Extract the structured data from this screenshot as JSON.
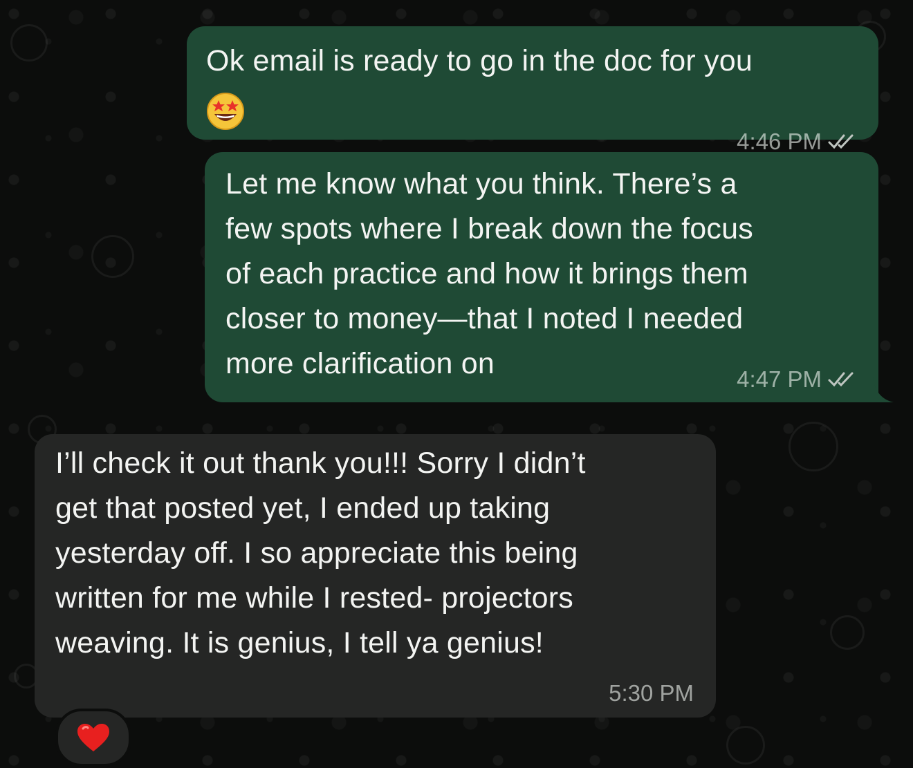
{
  "messages": [
    {
      "direction": "outgoing",
      "text": "Ok email is ready to go in the doc for you",
      "emoji": "star-struck",
      "time": "4:46 PM",
      "status": "read"
    },
    {
      "direction": "outgoing",
      "text": "Let me know what you think. There’s a\nfew spots where I break down the focus\nof each practice and how it brings them\ncloser to money—that I noted I needed\nmore clarification on",
      "time": "4:47 PM",
      "status": "read"
    },
    {
      "direction": "incoming",
      "text": "I’ll check it out thank you!!! Sorry I didn’t\nget that posted yet, I ended up taking\nyesterday off. I so appreciate this being\nwritten for me while I rested- projectors\nweaving. It is genius, I tell ya genius!",
      "time": "5:30 PM"
    }
  ],
  "reaction": {
    "emoji": "❤️",
    "icon": "heart-icon"
  },
  "colors": {
    "outgoing_bubble": "#1f4a35",
    "incoming_bubble": "#252625",
    "background": "#0c0d0c",
    "text": "#f3f4f2",
    "meta": "#9aa39d"
  }
}
